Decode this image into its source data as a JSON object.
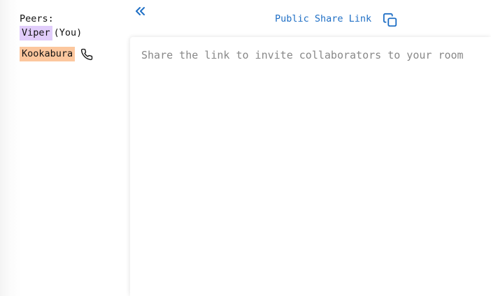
{
  "sidebar": {
    "title": "Peers:",
    "peers": [
      {
        "name": "Viper",
        "suffix": "(You)",
        "color": "#e1cdfb",
        "icon": null
      },
      {
        "name": "Kookabura",
        "suffix": "",
        "color": "#fcc79e",
        "icon": "phone-icon"
      }
    ]
  },
  "header": {
    "collapse_icon": "double-chevron-left-icon",
    "share_link_label": "Public Share Link",
    "copy_icon": "copy-icon"
  },
  "editor": {
    "placeholder": "Share the link to invite collaborators to your room"
  },
  "colors": {
    "accent": "#1f6fc5",
    "text": "#111111",
    "placeholder": "#888888"
  }
}
